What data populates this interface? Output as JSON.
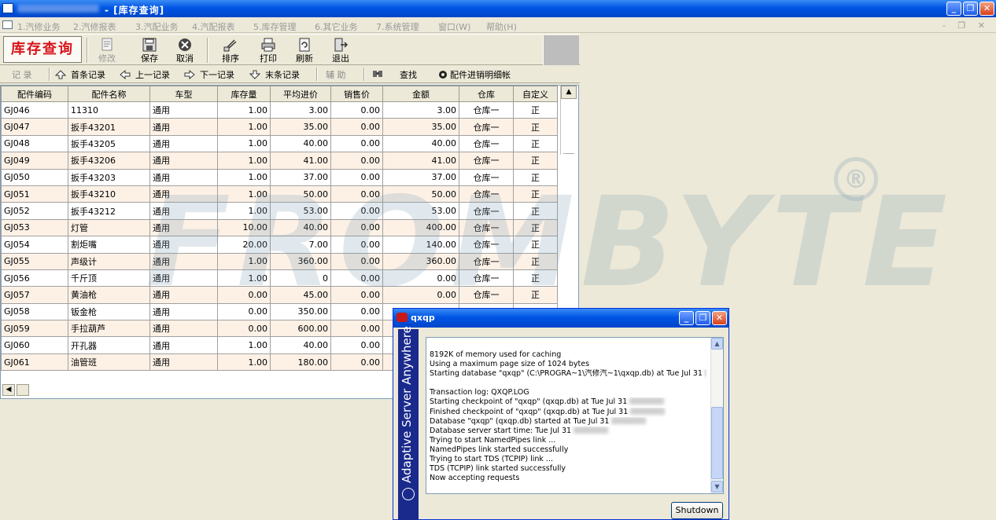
{
  "window": {
    "title": "- [库存查询]",
    "buttons": [
      "_",
      "❐",
      "✕"
    ]
  },
  "menu": {
    "items": [
      "1.汽修业务",
      "2.汽修报表",
      "3.汽配业务",
      "4.汽配报表",
      "5.库存管理",
      "6.其它业务",
      "7.系统管理",
      "窗口(W)",
      "帮助(H)"
    ],
    "mdi_controls": "- ❐ ✕"
  },
  "toolbar": {
    "brand": "库存查询",
    "buttons": {
      "modify": "修改",
      "save": "保存",
      "cancel": "取消",
      "sort": "排序",
      "print": "打印",
      "refresh": "刷新",
      "exit": "退出"
    }
  },
  "nav": {
    "record": "记 录",
    "first": "首条记录",
    "prev": "上一记录",
    "next": "下一记录",
    "last": "末条记录",
    "aux": "辅 助",
    "find": "查找",
    "detail": "配件进销明细帐"
  },
  "grid": {
    "columns": [
      "配件编码",
      "配件名称",
      "车型",
      "库存量",
      "平均进价",
      "销售价",
      "金额",
      "仓库",
      "自定义"
    ],
    "rows": [
      [
        "GJ046",
        "11310",
        "通用",
        "1.00",
        "3.00",
        "0.00",
        "3.00",
        "仓库一",
        "正"
      ],
      [
        "GJ047",
        "扳手43201",
        "通用",
        "1.00",
        "35.00",
        "0.00",
        "35.00",
        "仓库一",
        "正"
      ],
      [
        "GJ048",
        "扳手43205",
        "通用",
        "1.00",
        "40.00",
        "0.00",
        "40.00",
        "仓库一",
        "正"
      ],
      [
        "GJ049",
        "扳手43206",
        "通用",
        "1.00",
        "41.00",
        "0.00",
        "41.00",
        "仓库一",
        "正"
      ],
      [
        "GJ050",
        "扳手43203",
        "通用",
        "1.00",
        "37.00",
        "0.00",
        "37.00",
        "仓库一",
        "正"
      ],
      [
        "GJ051",
        "扳手43210",
        "通用",
        "1.00",
        "50.00",
        "0.00",
        "50.00",
        "仓库一",
        "正"
      ],
      [
        "GJ052",
        "扳手43212",
        "通用",
        "1.00",
        "53.00",
        "0.00",
        "53.00",
        "仓库一",
        "正"
      ],
      [
        "GJ053",
        "灯管",
        "通用",
        "10.00",
        "40.00",
        "0.00",
        "400.00",
        "仓库一",
        "正"
      ],
      [
        "GJ054",
        "割炬嘴",
        "通用",
        "20.00",
        "7.00",
        "0.00",
        "140.00",
        "仓库一",
        "正"
      ],
      [
        "GJ055",
        "声级计",
        "通用",
        "1.00",
        "360.00",
        "0.00",
        "360.00",
        "仓库一",
        "正"
      ],
      [
        "GJ056",
        "千斤顶",
        "通用",
        "1.00",
        "0",
        "0.00",
        "0.00",
        "仓库一",
        "正"
      ],
      [
        "GJ057",
        "黄油枪",
        "通用",
        "0.00",
        "45.00",
        "0.00",
        "0.00",
        "仓库一",
        "正"
      ],
      [
        "GJ058",
        "钣金枪",
        "通用",
        "0.00",
        "350.00",
        "0.00",
        "",
        "",
        ""
      ],
      [
        "GJ059",
        "手拉葫芦",
        "通用",
        "0.00",
        "600.00",
        "0.00",
        "",
        "",
        ""
      ],
      [
        "GJ060",
        "开孔器",
        "通用",
        "1.00",
        "40.00",
        "0.00",
        "",
        "",
        ""
      ],
      [
        "GJ061",
        "油管班",
        "通用",
        "1.00",
        "180.00",
        "0.00",
        "",
        "",
        ""
      ]
    ]
  },
  "watermark": {
    "text": "FROMBYTE",
    "mark": "®"
  },
  "dialog": {
    "title": "qxqp",
    "side_text": "Adaptive Server Anywhere",
    "log": [
      "8192K of memory used for caching",
      "Using a maximum page size of 1024 bytes",
      "Starting database \"qxqp\" (C:\\PROGRA~1\\汽修汽~1\\qxqp.db) at Tue Jul 31",
      "",
      "Transaction log: QXQP.LOG",
      "Starting checkpoint of \"qxqp\" (qxqp.db) at Tue Jul 31",
      "Finished checkpoint of \"qxqp\" (qxqp.db) at Tue Jul 31",
      "Database \"qxqp\" (qxqp.db) started at Tue Jul 31",
      "Database server start time: Tue Jul 31",
      "Trying to start NamedPipes link ...",
      "    NamedPipes link started successfully",
      "Trying to start TDS (TCPIP) link ...",
      "    TDS (TCPIP) link started successfully",
      "Now accepting requests"
    ],
    "shutdown": "Shutdown"
  },
  "colors": {
    "titlebar": "#0055e5",
    "brand_red": "#d8141c",
    "row_alt": "#fdf1e6",
    "dialog_side": "#1a2a8c"
  }
}
